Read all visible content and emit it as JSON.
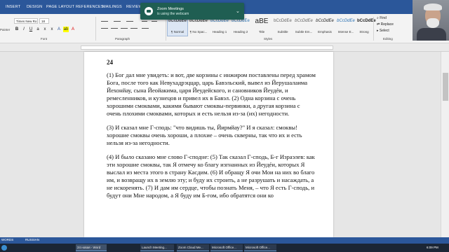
{
  "ribbon": {
    "tabs": [
      "INSERT",
      "DESIGN",
      "PAGE LAYOUT",
      "REFERENCES",
      "MAILINGS",
      "REVIEW"
    ],
    "font_name": "Times New Ro",
    "font_size": "18",
    "painter_label": "Painter",
    "groups": {
      "font": "Font",
      "paragraph": "Paragraph",
      "styles": "Styles",
      "editing": "Editing"
    },
    "styles": [
      {
        "sample": "bCcDdEe",
        "name": "¶ Normal"
      },
      {
        "sample": "bCcDdEe",
        "name": "¶ No Spac..."
      },
      {
        "sample": "bCcDdEe",
        "name": "Heading 1"
      },
      {
        "sample": "bCcDdEe",
        "name": "Heading 2"
      },
      {
        "sample": "aBE",
        "name": "Title"
      },
      {
        "sample": "bCcDdEe",
        "name": "Subtitle"
      },
      {
        "sample": "bCcDdEe",
        "name": "Subtle Em..."
      },
      {
        "sample": "bCcDdEe",
        "name": "Emphasis"
      },
      {
        "sample": "bCcDdEe",
        "name": "Intense E..."
      },
      {
        "sample": "bCcDdEe",
        "name": "Strong"
      }
    ],
    "editing": {
      "find": "Find",
      "replace": "Replace",
      "select": "Select"
    }
  },
  "zoom": {
    "title": "Zoom Meetings",
    "subtitle": "is using the webcam"
  },
  "document": {
    "chapter": "24",
    "paragraphs": [
      "(1) Бог дал мне увидеть: и вот, две корзины с инжиром поставлены перед храмом Бога, после того как Невухадрэццар, царь Бавэльский, вывел из Йерушалаима Йехонйау, сына Йеойакима, царя Йеудейского, и сановников Йеудéи, и ремесленников, и кузнецов и привел их в Бавэл. (2) Одна корзина с очень хорошими смоквами, какими бывают смоквы-первинки, а другая корзина с очень плохими смоквами, которых и есть нельзя из-за (их) негодности.",
      "(3) И сказал мне Г-сподь: \"что видишь ты, Йирмйау?\" И я сказал: смоквы! хорошие смоквы очень хороши, а плохие – очень скверны, так что их и есть нельзя из-за негодности.",
      "(4) И было сказано мне слово Г-сподне: (5) Так сказал Г-сподь, Б-г Израэлев: как эти хорошие смоквы, так Я отмечу ко благу изгнанных из Йеудéи, которых Я выслал из места этого в страну Касдим. (6) И обращу Я очи Мои на них во благо им, и возвращу их в землю эту; и буду их строить, а не разрушать и насаждать, а не искоренять. (7) И дам им сердце, чтобы познать Меня, – что Я есть Г-сподь, и будут они Мне народом, а Я буду им Б-гом, ибо обратятся они ко"
    ]
  },
  "status": {
    "words": "WORDS",
    "language": "RUSSIAN"
  },
  "taskbar": {
    "items": [
      "24 новая - Word",
      "Launch Meeting...",
      "Zoom Cloud Me...",
      "Microsoft Office...",
      "Microsoft Office..."
    ],
    "clock": "6:09 PM"
  }
}
